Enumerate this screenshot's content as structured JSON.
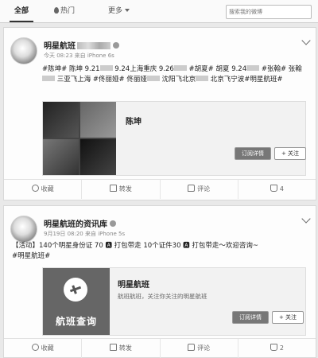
{
  "nav": {
    "tabs": [
      {
        "label": "全部"
      },
      {
        "label": "热门"
      },
      {
        "label": "更多"
      }
    ],
    "search_placeholder": "搜索我的微博"
  },
  "posts": [
    {
      "username": "明星航班",
      "meta": "今天 08:23 来自 iPhone 6s",
      "text_parts": [
        "#陈坤# 陈坤 9.21",
        " 9.24上海重庆 9.26",
        " #胡夏# 胡夏 9.24",
        " #张翰# 张翰",
        "三亚飞上海 #佟丽娅# 佟丽娅",
        "沈阳飞北京",
        "北京飞宁波#明星航班#"
      ],
      "preview_title": "陈坤",
      "detail_label": "订阅详情",
      "follow_label": "+ 关注",
      "actions": {
        "favorite": "收藏",
        "forward": "转发",
        "comment": "评论",
        "like": "4"
      }
    },
    {
      "username": "明星航班的资讯库",
      "meta": "9月19日 08:20 来自 iPhone 5s",
      "text_line1": "【活动】140个明星身份证 70 🅰 打包带走 10个证件30 🅰 打包带走～欢迎咨询~",
      "text_line2": "#明星航班#",
      "preview_title": "明星航班",
      "preview_desc": "航班航班，关注你关注的明星航班",
      "image_caption": "航班查询",
      "detail_label": "订阅详情",
      "follow_label": "+ 关注",
      "actions": {
        "favorite": "收藏",
        "forward": "转发",
        "comment": "评论",
        "like": "2"
      }
    }
  ]
}
